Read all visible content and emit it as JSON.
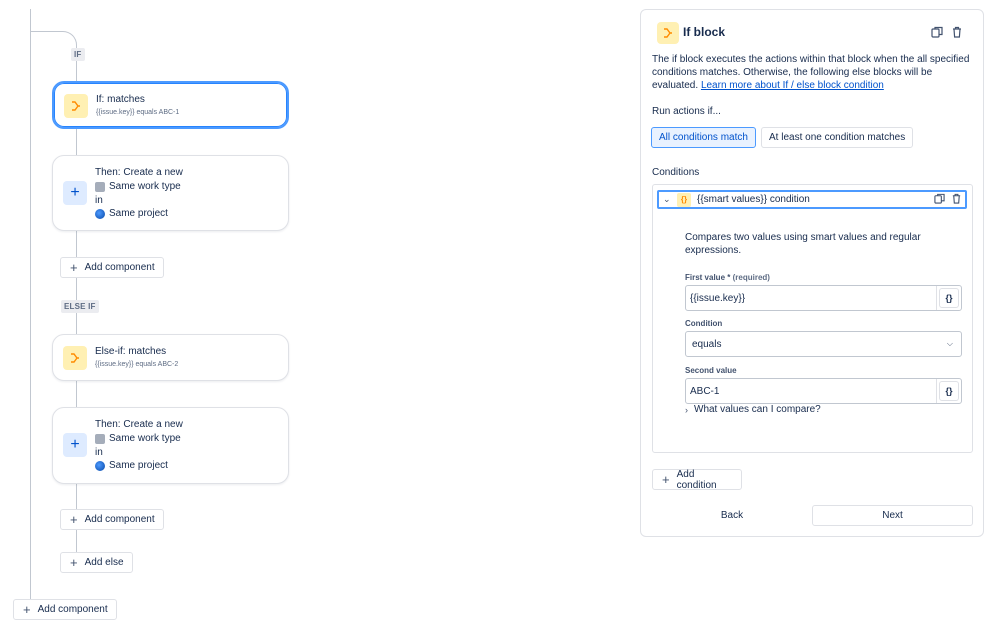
{
  "flow": {
    "if_tag": "IF",
    "else_if_tag": "ELSE IF",
    "if_card": {
      "title": "If: matches",
      "subtitle": "{{issue.key}} equals ABC-1"
    },
    "then_card_1": {
      "title": "Then: Create a new",
      "work_type": "Same work type",
      "in": "in",
      "project": "Same project"
    },
    "add_component_1": "Add component",
    "else_if_card": {
      "title": "Else-if: matches",
      "subtitle": "{{issue.key}} equals ABC-2"
    },
    "then_card_2": {
      "title": "Then: Create a new",
      "work_type": "Same work type",
      "in": "in",
      "project": "Same project"
    },
    "add_component_2": "Add component",
    "add_else": "Add else",
    "add_component_3": "Add component"
  },
  "panel": {
    "title": "If block",
    "description": "The if block executes the actions within that block when the all specified conditions matches. Otherwise, the following else blocks will be evaluated.",
    "learn_more": "Learn more about If / else block condition",
    "run_actions_label": "Run actions if...",
    "match_options": [
      "All conditions match",
      "At least one condition matches"
    ],
    "selected_match": "All conditions match",
    "conditions_label": "Conditions",
    "condition": {
      "title": "{{smart values}} condition",
      "description": "Compares two values using smart values and regular expressions.",
      "first_value_label": "First value",
      "required_mark": "*",
      "required_text": "(required)",
      "first_value": "{{issue.key}}",
      "condition_label": "Condition",
      "condition_value": "equals",
      "second_value_label": "Second value",
      "second_value": "ABC-1",
      "expand_text": "What values can I compare?"
    },
    "add_condition": "Add condition",
    "back": "Back",
    "next": "Next"
  },
  "icons": {
    "branch": "branch-icon",
    "plus": "plus-icon",
    "duplicate": "duplicate-icon",
    "trash": "trash-icon",
    "chevron": "chevron-icon",
    "smart_values": "smart-values-icon"
  },
  "colors": {
    "accent": "#0052cc",
    "selection_border": "#4c9aff",
    "branch_icon": "#ff8b00",
    "branch_icon_bg": "#fff0b3"
  }
}
